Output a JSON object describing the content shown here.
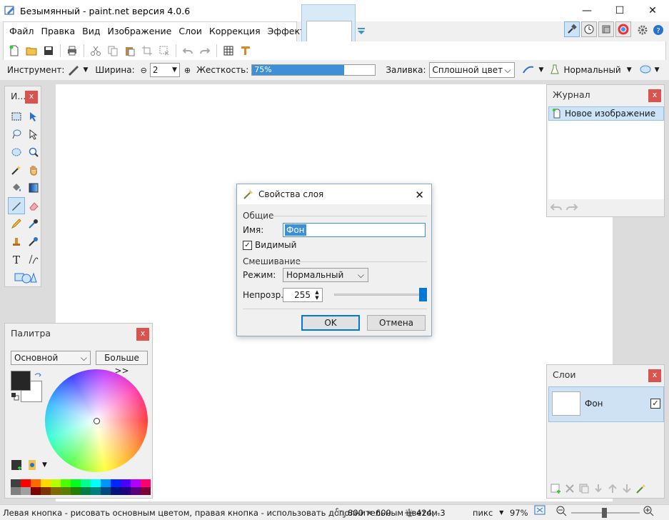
{
  "window": {
    "title": "Безымянный - paint.net версия 4.0.6",
    "minimize": "—",
    "maximize": "☐",
    "close": "✕"
  },
  "menu": [
    "Файл",
    "Правка",
    "Вид",
    "Изображение",
    "Слои",
    "Коррекция",
    "Эффекты"
  ],
  "toolbar2": {
    "tool_label": "Инструмент:",
    "width_label": "Ширина:",
    "width_value": "2",
    "hardness_label": "Жесткость:",
    "hardness_value": "75%",
    "hardness_fraction": 0.75,
    "fill_label": "Заливка:",
    "fill_value": "Сплошной цвет",
    "blend_value": "Нормальный"
  },
  "tools_panel": {
    "title": "И...",
    "close": "x"
  },
  "history_panel": {
    "title": "Журнал",
    "close": "x",
    "items": [
      "Новое изображение"
    ]
  },
  "palette_panel": {
    "title": "Палитра",
    "close": "x",
    "mode": "Основной",
    "more_button": "Больше >>",
    "primary_color": "#262626",
    "secondary_color": "#ffffff"
  },
  "layers_panel": {
    "title": "Слои",
    "close": "x",
    "layers": [
      {
        "name": "Фон",
        "visible": true
      }
    ]
  },
  "dialog": {
    "title": "Свойства слоя",
    "general_section": "Общие",
    "name_label": "Имя:",
    "name_value": "Фон",
    "visible_label": "Видимый",
    "visible_checked": true,
    "blending_section": "Смешивание",
    "mode_label": "Режим:",
    "mode_value": "Нормальный",
    "opacity_label": "Непрозр.:",
    "opacity_value": "255",
    "ok_button": "OK",
    "cancel_button": "Отмена"
  },
  "statusbar": {
    "hint": "Левая кнопка - рисовать основным цветом, правая кнопка - использовать дополнительным цветом.",
    "image_size": "800 × 600",
    "cursor_pos": "424, -3",
    "units": "пикс",
    "zoom": "97%"
  },
  "palette_colors_top": [
    "#404040",
    "#ff0000",
    "#ff6a00",
    "#ffd800",
    "#b6ff00",
    "#4cff00",
    "#00ff21",
    "#00ff90",
    "#00ffff",
    "#0094ff",
    "#0026ff",
    "#4800ff",
    "#b200ff",
    "#ff006e"
  ],
  "palette_colors_bottom": [
    "#808080",
    "#a0a0a0",
    "#7f0000",
    "#7f3300",
    "#7f6a00",
    "#5b7f00",
    "#267f00",
    "#007f46",
    "#007f7f",
    "#004a7f",
    "#00137f",
    "#21007f",
    "#57007f",
    "#7f0037"
  ]
}
